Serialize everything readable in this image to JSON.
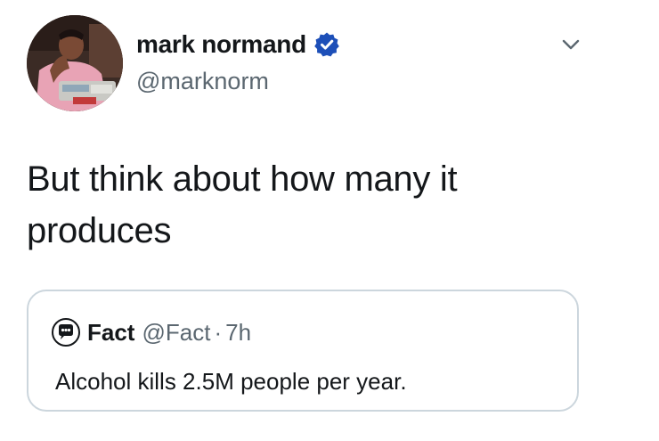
{
  "author": {
    "display_name": "mark normand",
    "handle": "@marknorm",
    "verified": true,
    "verified_color": "#1d9bf0"
  },
  "tweet": {
    "text": "But think about how many it produces"
  },
  "quoted_tweet": {
    "display_name": "Fact",
    "handle": "@Fact",
    "separator": "·",
    "time": "7h",
    "text": "Alcohol kills 2.5M people per year."
  },
  "icons": {
    "menu": "chevron-down-icon",
    "verified": "verified-badge-icon",
    "avatar": "profile-photo",
    "quoted_avatar": "speech-bubble-logo"
  },
  "colors": {
    "text": "#14171a",
    "secondary_text": "#5b6770",
    "border": "#ccd6dd"
  }
}
